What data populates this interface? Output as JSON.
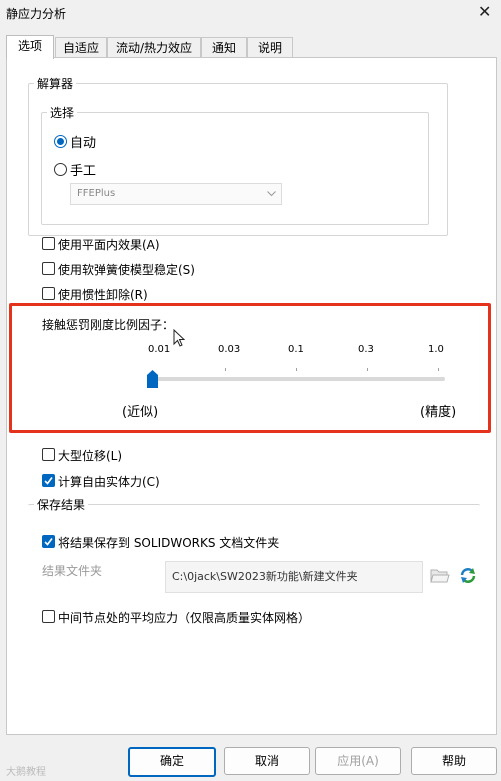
{
  "window": {
    "title": "静应力分析",
    "close_glyph": "✕"
  },
  "tabs": [
    {
      "label": "选项",
      "active": true
    },
    {
      "label": "自适应"
    },
    {
      "label": "流动/热力效应"
    },
    {
      "label": "通知"
    },
    {
      "label": "说明"
    }
  ],
  "solver": {
    "legend": "解算器",
    "select_legend": "选择",
    "auto_label": "自动",
    "manual_label": "手工",
    "solver_value": "FFEPlus"
  },
  "options": {
    "inplane": "使用平面内效果(A)",
    "soft_spring": "使用软弹簧使模型稳定(S)",
    "inertial_relief": "使用惯性卸除(R)"
  },
  "contact_penalty": {
    "label": "接触惩罚刚度比例因子：",
    "ticks": [
      "0.01",
      "0.03",
      "0.1",
      "0.3",
      "1.0"
    ],
    "left_label": "(近似)",
    "right_label": "(精度)",
    "value": "0.01",
    "highlight_color": "#e5321d"
  },
  "checks": {
    "large_displacement": "大型位移(L)",
    "compute_free_body": "计算自由实体力(C)"
  },
  "save_results": {
    "legend": "保存结果",
    "save_to_folder": "将结果保存到 SOLIDWORKS 文档文件夹",
    "results_folder_label": "结果文件夹",
    "results_folder_value": "C:\\0jack\\SW2023新功能\\新建文件夹"
  },
  "mid_node": "中间节点处的平均应力（仅限高质量实体网格）",
  "buttons": {
    "ok": "确定",
    "cancel": "取消",
    "apply": "应用(A)",
    "help": "帮助"
  },
  "watermark": "大鹅教程",
  "accent_color": "#0067c0"
}
